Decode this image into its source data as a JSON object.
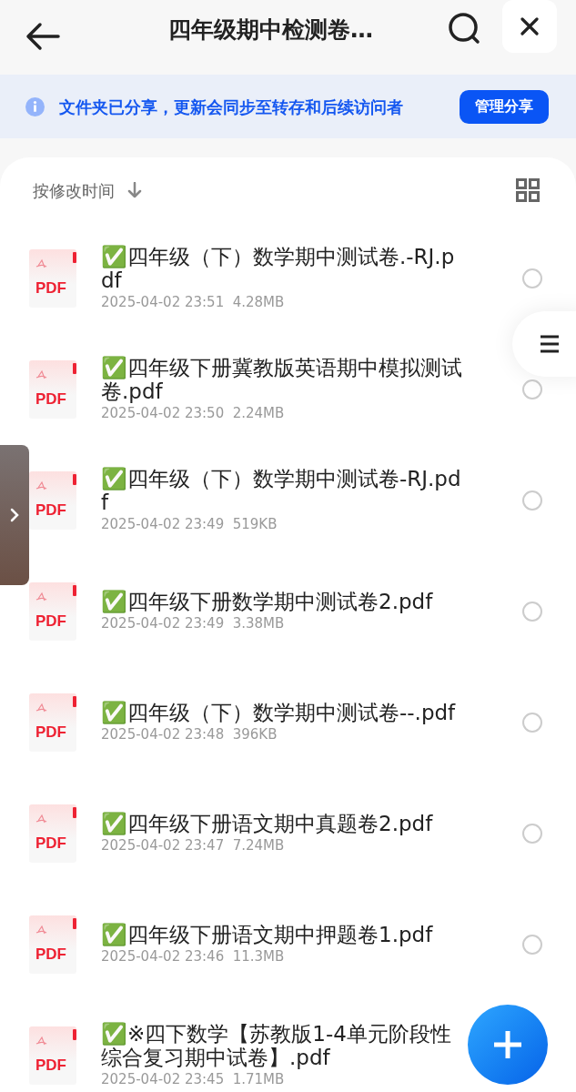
{
  "header": {
    "title": "四年级期中检测卷…"
  },
  "banner": {
    "text": "文件夹已分享，更新会同步至转存和后续访问者",
    "button": "管理分享"
  },
  "sort": {
    "label": "按修改时间"
  },
  "files": [
    {
      "icon_label": "PDF",
      "name": "✅四年级（下）数学期中测试卷.-RJ.pdf",
      "meta": "2025-04-02 23:51  4.28MB",
      "selected": false
    },
    {
      "icon_label": "PDF",
      "name": "✅四年级下册冀教版英语期中模拟测试卷.pdf",
      "meta": "2025-04-02 23:50  2.24MB",
      "selected": false
    },
    {
      "icon_label": "PDF",
      "name": "✅四年级（下）数学期中测试卷-RJ.pdf",
      "meta": "2025-04-02 23:49  519KB",
      "selected": false
    },
    {
      "icon_label": "PDF",
      "name": "✅四年级下册数学期中测试卷2.pdf",
      "meta": "2025-04-02 23:49  3.38MB",
      "selected": false
    },
    {
      "icon_label": "PDF",
      "name": "✅四年级（下）数学期中测试卷--.pdf",
      "meta": "2025-04-02 23:48  396KB",
      "selected": false
    },
    {
      "icon_label": "PDF",
      "name": "✅四年级下册语文期中真题卷2.pdf",
      "meta": "2025-04-02 23:47  7.24MB",
      "selected": false
    },
    {
      "icon_label": "PDF",
      "name": "✅四年级下册语文期中押题卷1.pdf",
      "meta": "2025-04-02 23:46  11.3MB",
      "selected": false
    },
    {
      "icon_label": "PDF",
      "name": "✅※四下数学【苏教版1-4单元阶段性综合复习期中试卷】.pdf",
      "meta": "2025-04-02 23:45  1.71MB"
    }
  ]
}
